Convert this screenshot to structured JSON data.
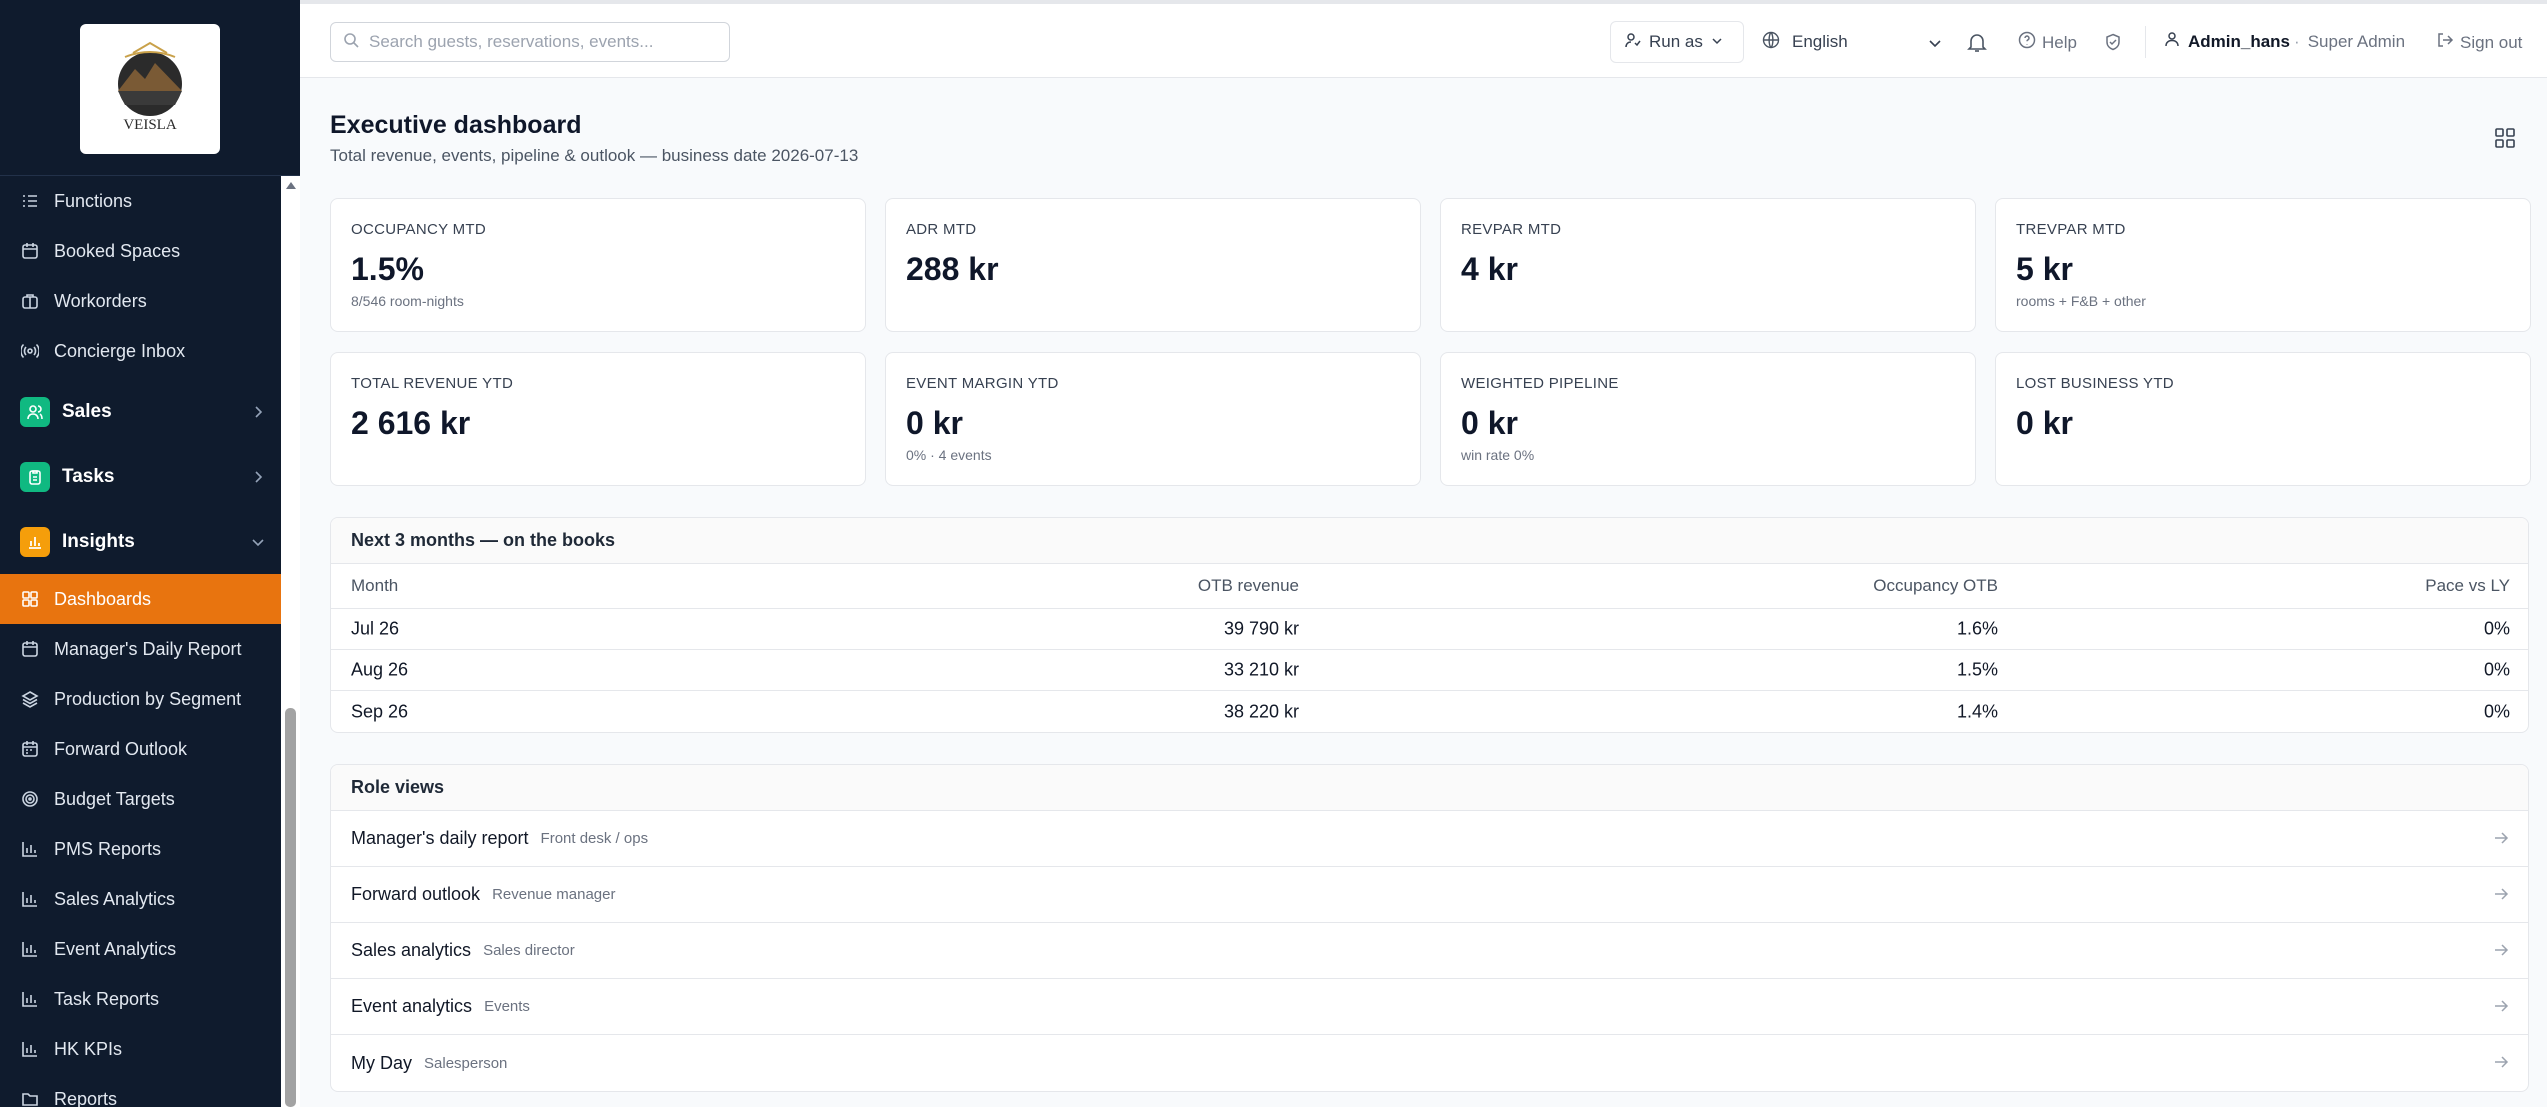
{
  "brand": {
    "logo_text": "VEISLA"
  },
  "sidebar": {
    "items_top": [
      {
        "label": "Functions",
        "icon": "list-icon"
      },
      {
        "label": "Booked Spaces",
        "icon": "calendar-icon"
      },
      {
        "label": "Workorders",
        "icon": "briefcase-icon"
      },
      {
        "label": "Concierge Inbox",
        "icon": "broadcast-icon"
      }
    ],
    "groups": [
      {
        "label": "Sales",
        "color": "#10b981",
        "icon": "users-icon",
        "expanded": false
      },
      {
        "label": "Tasks",
        "color": "#10b981",
        "icon": "clipboard-icon",
        "expanded": false
      },
      {
        "label": "Insights",
        "color": "#f59e0b",
        "icon": "bar-chart-icon",
        "expanded": true
      }
    ],
    "insights_items": [
      {
        "label": "Dashboards",
        "icon": "grid-icon",
        "active": true
      },
      {
        "label": "Manager's Daily Report",
        "icon": "calendar-icon"
      },
      {
        "label": "Production by Segment",
        "icon": "layers-icon"
      },
      {
        "label": "Forward Outlook",
        "icon": "calendar-icon"
      },
      {
        "label": "Budget Targets",
        "icon": "target-icon"
      },
      {
        "label": "PMS Reports",
        "icon": "bar-chart-icon"
      },
      {
        "label": "Sales Analytics",
        "icon": "bar-chart-icon"
      },
      {
        "label": "Event Analytics",
        "icon": "bar-chart-icon"
      },
      {
        "label": "Task Reports",
        "icon": "bar-chart-icon"
      },
      {
        "label": "HK KPIs",
        "icon": "bar-chart-icon"
      },
      {
        "label": "Reports",
        "icon": "folder-icon"
      }
    ]
  },
  "topbar": {
    "search_placeholder": "Search guests, reservations, events...",
    "run_as": "Run as",
    "language": "English",
    "help": "Help",
    "user_name": "Admin_hans",
    "user_sep": "·",
    "user_role": "Super Admin",
    "sign_out": "Sign out"
  },
  "page": {
    "title": "Executive dashboard",
    "subtitle": "Total revenue, events, pipeline & outlook — business date 2026-07-13"
  },
  "kpis": [
    {
      "label": "OCCUPANCY MTD",
      "value": "1.5%",
      "note": "8/546 room-nights"
    },
    {
      "label": "ADR MTD",
      "value": "288 kr",
      "note": ""
    },
    {
      "label": "REVPAR MTD",
      "value": "4 kr",
      "note": ""
    },
    {
      "label": "TREVPAR MTD",
      "value": "5 kr",
      "note": "rooms + F&B + other"
    },
    {
      "label": "TOTAL REVENUE YTD",
      "value": "2 616 kr",
      "note": ""
    },
    {
      "label": "EVENT MARGIN YTD",
      "value": "0 kr",
      "note": "0% · 4 events"
    },
    {
      "label": "WEIGHTED PIPELINE",
      "value": "0 kr",
      "note": "win rate 0%"
    },
    {
      "label": "LOST BUSINESS YTD",
      "value": "0 kr",
      "note": ""
    }
  ],
  "otb": {
    "title": "Next 3 months — on the books",
    "columns": [
      "Month",
      "OTB revenue",
      "Occupancy OTB",
      "Pace vs LY"
    ],
    "rows": [
      [
        "Jul 26",
        "39 790 kr",
        "1.6%",
        "0%"
      ],
      [
        "Aug 26",
        "33 210 kr",
        "1.5%",
        "0%"
      ],
      [
        "Sep 26",
        "38 220 kr",
        "1.4%",
        "0%"
      ]
    ]
  },
  "role_views": {
    "title": "Role views",
    "items": [
      {
        "name": "Manager's daily report",
        "tag": "Front desk / ops"
      },
      {
        "name": "Forward outlook",
        "tag": "Revenue manager"
      },
      {
        "name": "Sales analytics",
        "tag": "Sales director"
      },
      {
        "name": "Event analytics",
        "tag": "Events"
      },
      {
        "name": "My Day",
        "tag": "Salesperson"
      }
    ]
  }
}
